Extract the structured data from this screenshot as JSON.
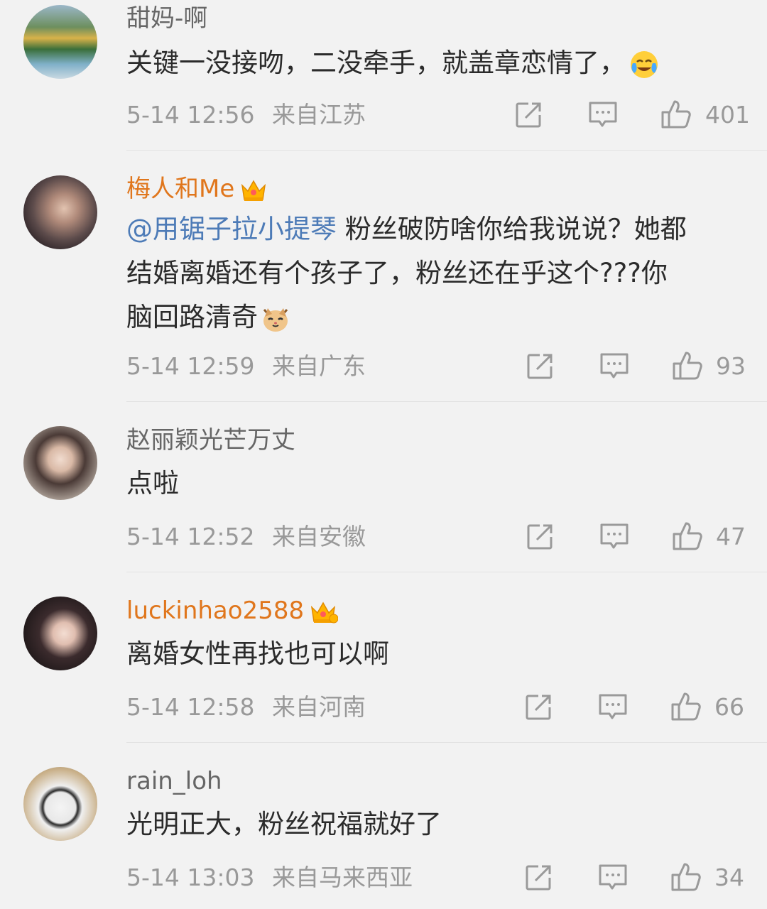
{
  "comments": [
    {
      "username": "甜妈-啊",
      "vip": false,
      "text": "关键一没接吻，二没牵手，就盖章恋情了，",
      "text_emoji": "laughing-tears-emoji",
      "time": "5-14 12:56",
      "location": "来自江苏",
      "likes": "401"
    },
    {
      "username": "梅人和Me",
      "vip": true,
      "mention": "@用锯子拉小提琴",
      "text_line1": " 粉丝破防啥你给我说说？她都",
      "text_line2": "结婚离婚还有个孩子了，粉丝还在乎这个???你",
      "text_line3": "脑回路清奇",
      "text_emoji": "cat-emoji",
      "time": "5-14 12:59",
      "location": "来自广东",
      "likes": "93"
    },
    {
      "username": "赵丽颖光芒万丈",
      "vip": false,
      "text": "点啦",
      "time": "5-14 12:52",
      "location": "来自安徽",
      "likes": "47"
    },
    {
      "username": "luckinhao2588",
      "vip": true,
      "text": "离婚女性再找也可以啊",
      "time": "5-14 12:58",
      "location": "来自河南",
      "likes": "66"
    },
    {
      "username": "rain_loh",
      "vip": false,
      "text": "光明正大，粉丝祝福就好了",
      "time": "5-14 13:03",
      "location": "来自马来西亚",
      "likes": "34"
    }
  ],
  "icons": {
    "share": "share-icon",
    "reply": "comment-icon",
    "like": "thumbs-up-icon",
    "crown": "vip-crown-icon"
  },
  "colors": {
    "background": "#f2f2f2",
    "vip_name": "#e0761c",
    "mention": "#4d7bb7",
    "meta": "#999999"
  }
}
